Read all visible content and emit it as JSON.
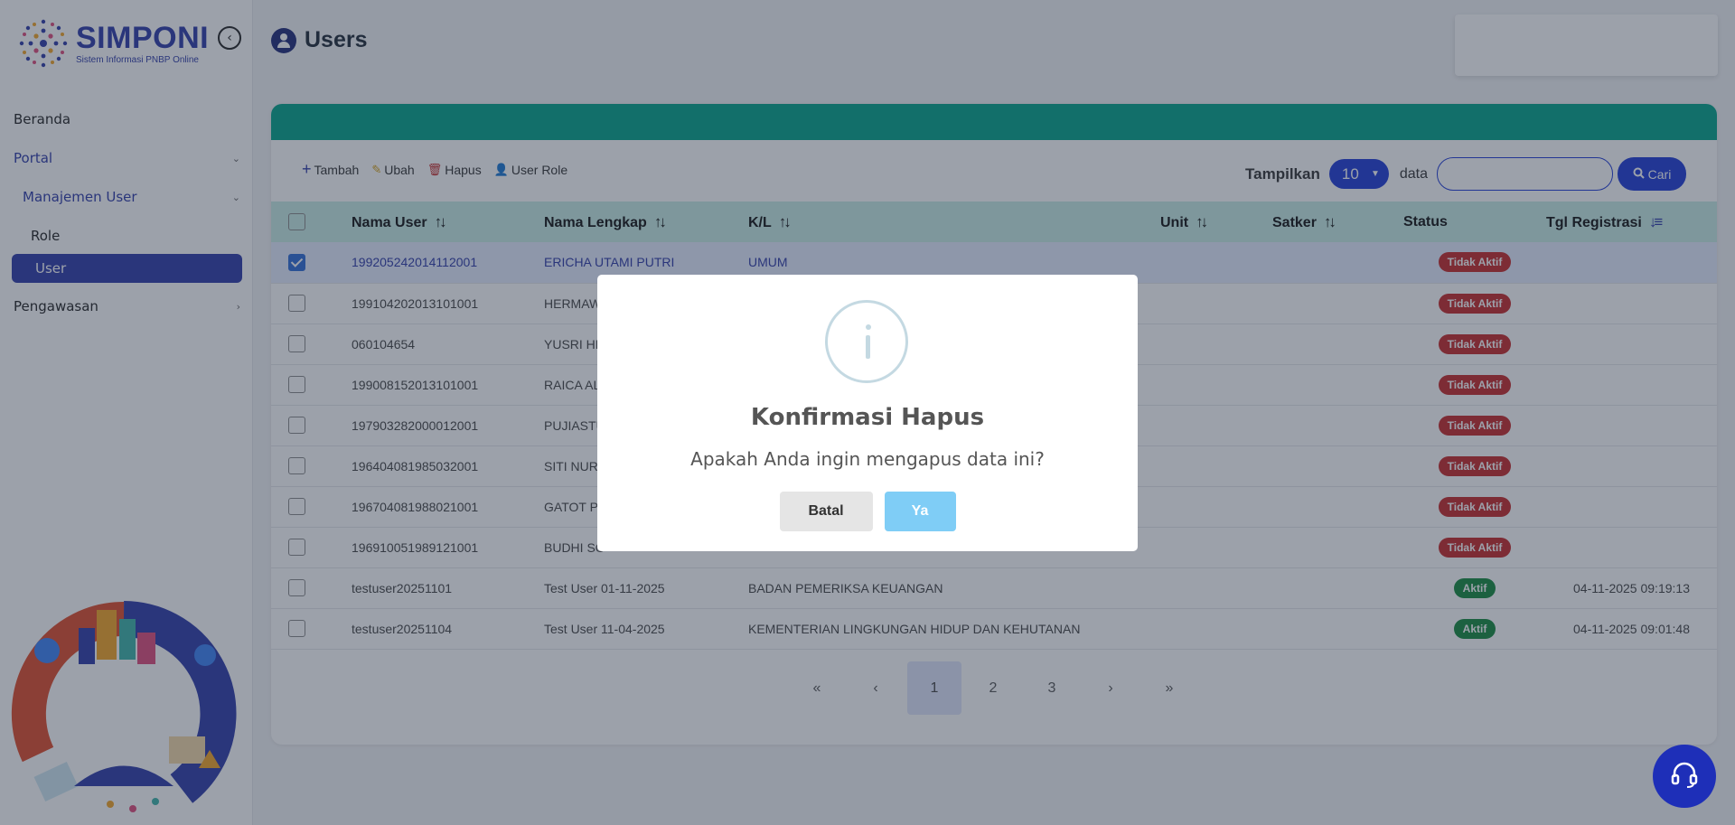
{
  "app": {
    "title": "SIMPONI",
    "subtitle": "Sistem Informasi PNBP Online"
  },
  "sidebar": {
    "items": [
      {
        "label": "Beranda"
      },
      {
        "label": "Portal"
      },
      {
        "label": "Manajemen User"
      },
      {
        "label": "Role"
      },
      {
        "label": "User"
      },
      {
        "label": "Pengawasan"
      }
    ]
  },
  "page": {
    "title": "Users"
  },
  "toolbar": {
    "add_label": "Tambah",
    "edit_label": "Ubah",
    "delete_label": "Hapus",
    "role_label": "User Role"
  },
  "controls": {
    "show_label": "Tampilkan",
    "per_page": "10",
    "data_label": "data",
    "search_placeholder": "",
    "search_button": "Cari"
  },
  "table": {
    "headers": [
      "Nama User",
      "Nama Lengkap",
      "K/L",
      "Unit",
      "Satker",
      "Status",
      "Tgl Registrasi"
    ],
    "rows": [
      {
        "nama_user": "199205242014112001",
        "nama_lengkap": "ERICHA UTAMI PUTRI",
        "kl": "UMUM",
        "unit": "",
        "satker": "",
        "status": "Tidak Aktif",
        "tgl": "",
        "selected": true
      },
      {
        "nama_user": "199104202013101001",
        "nama_lengkap": "HERMAW",
        "kl": "",
        "unit": "",
        "satker": "",
        "status": "Tidak Aktif",
        "tgl": ""
      },
      {
        "nama_user": "060104654",
        "nama_lengkap": "YUSRI HE",
        "kl": "",
        "unit": "",
        "satker": "",
        "status": "Tidak Aktif",
        "tgl": ""
      },
      {
        "nama_user": "199008152013101001",
        "nama_lengkap": "RAICA AL",
        "kl": "",
        "unit": "",
        "satker": "",
        "status": "Tidak Aktif",
        "tgl": ""
      },
      {
        "nama_user": "197903282000012001",
        "nama_lengkap": "PUJIASTU",
        "kl": "",
        "unit": "",
        "satker": "",
        "status": "Tidak Aktif",
        "tgl": ""
      },
      {
        "nama_user": "196404081985032001",
        "nama_lengkap": "SITI NURI",
        "kl": "",
        "unit": "",
        "satker": "",
        "status": "Tidak Aktif",
        "tgl": ""
      },
      {
        "nama_user": "196704081988021001",
        "nama_lengkap": "GATOT PI",
        "kl": "",
        "unit": "",
        "satker": "",
        "status": "Tidak Aktif",
        "tgl": ""
      },
      {
        "nama_user": "196910051989121001",
        "nama_lengkap": "BUDHI SO",
        "kl": "",
        "unit": "",
        "satker": "",
        "status": "Tidak Aktif",
        "tgl": ""
      },
      {
        "nama_user": "testuser20251101",
        "nama_lengkap": "Test User 01-11-2025",
        "kl": "BADAN PEMERIKSA KEUANGAN",
        "unit": "",
        "satker": "",
        "status": "Aktif",
        "tgl": "04-11-2025 09:19:13"
      },
      {
        "nama_user": "testuser20251104",
        "nama_lengkap": "Test User 11-04-2025",
        "kl": "KEMENTERIAN LINGKUNGAN HIDUP DAN KEHUTANAN",
        "unit": "",
        "satker": "",
        "status": "Aktif",
        "tgl": "04-11-2025 09:01:48"
      }
    ]
  },
  "pagination": {
    "first": "«",
    "prev": "‹",
    "pages": [
      "1",
      "2",
      "3"
    ],
    "next": "›",
    "last": "»",
    "current": "1"
  },
  "modal": {
    "title": "Konfirmasi Hapus",
    "message": "Apakah Anda ingin mengapus data ini?",
    "cancel_label": "Batal",
    "confirm_label": "Ya"
  },
  "colors": {
    "brand": "#2e3aa8",
    "header_band": "#00a389",
    "accent": "#1e3ad6",
    "status_inactive": "#c62828",
    "status_active": "#13893c",
    "confirm_button": "#7fcdf6"
  }
}
